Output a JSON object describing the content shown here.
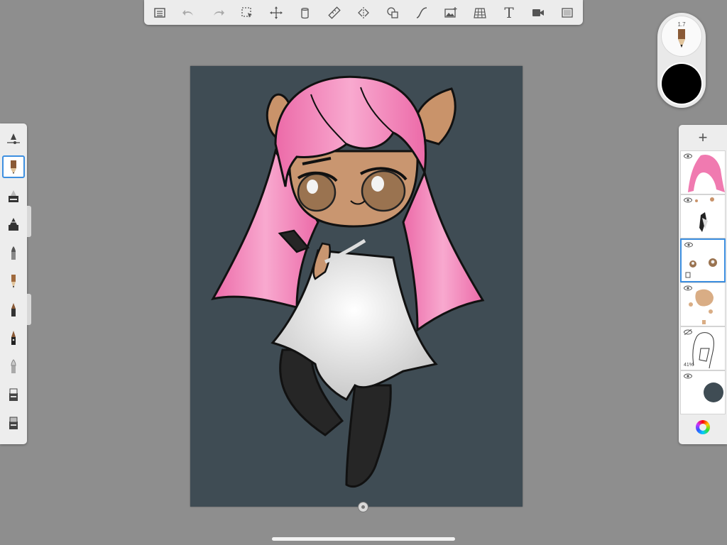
{
  "toolbar": {
    "items": [
      {
        "id": "gallery",
        "icon": "gallery-list-icon"
      },
      {
        "id": "undo",
        "icon": "undo-icon"
      },
      {
        "id": "redo",
        "icon": "redo-icon"
      },
      {
        "id": "selection",
        "icon": "selection-icon"
      },
      {
        "id": "transform",
        "icon": "transform-icon"
      },
      {
        "id": "fill",
        "icon": "fill-bucket-icon"
      },
      {
        "id": "ruler",
        "icon": "ruler-icon"
      },
      {
        "id": "symmetry",
        "icon": "symmetry-icon"
      },
      {
        "id": "shapes",
        "icon": "shapes-icon"
      },
      {
        "id": "stroke",
        "icon": "predictive-stroke-icon"
      },
      {
        "id": "image",
        "icon": "import-image-icon"
      },
      {
        "id": "perspective",
        "icon": "perspective-grid-icon"
      },
      {
        "id": "text",
        "icon": "text-icon"
      },
      {
        "id": "record",
        "icon": "time-lapse-icon"
      },
      {
        "id": "fullscreen",
        "icon": "fullscreen-icon"
      }
    ],
    "text_tool_label": "T"
  },
  "puck": {
    "brush_size": "1.7",
    "current_color": "#000000"
  },
  "brushes": [
    {
      "name": "brush-settings"
    },
    {
      "name": "pencil",
      "selected": true
    },
    {
      "name": "marker"
    },
    {
      "name": "airbrush"
    },
    {
      "name": "paintbrush"
    },
    {
      "name": "pen"
    },
    {
      "name": "ink-pen"
    },
    {
      "name": "technical-pen"
    },
    {
      "name": "blender"
    },
    {
      "name": "eraser"
    },
    {
      "name": "hard-eraser"
    }
  ],
  "layers": {
    "add_label": "+",
    "items": [
      {
        "name": "hair-color-layer",
        "visible": true
      },
      {
        "name": "details-layer",
        "visible": true
      },
      {
        "name": "eyes-skin-layer",
        "visible": true,
        "selected": true
      },
      {
        "name": "skin-layer",
        "visible": true
      },
      {
        "name": "line-art-layer",
        "visible": false,
        "opacity_label": "41%"
      },
      {
        "name": "background-layer",
        "visible": true,
        "color": "#3f4c54"
      }
    ]
  },
  "canvas": {
    "background": "#3f4c54"
  },
  "palette": {
    "hair": "#f07ab0",
    "hair_light": "#f8a9cf",
    "skin": "#c99670",
    "horn": "#c9936a",
    "dress": "#e9e9e9",
    "stockings": "#262626",
    "eyes": "#9a7350"
  }
}
